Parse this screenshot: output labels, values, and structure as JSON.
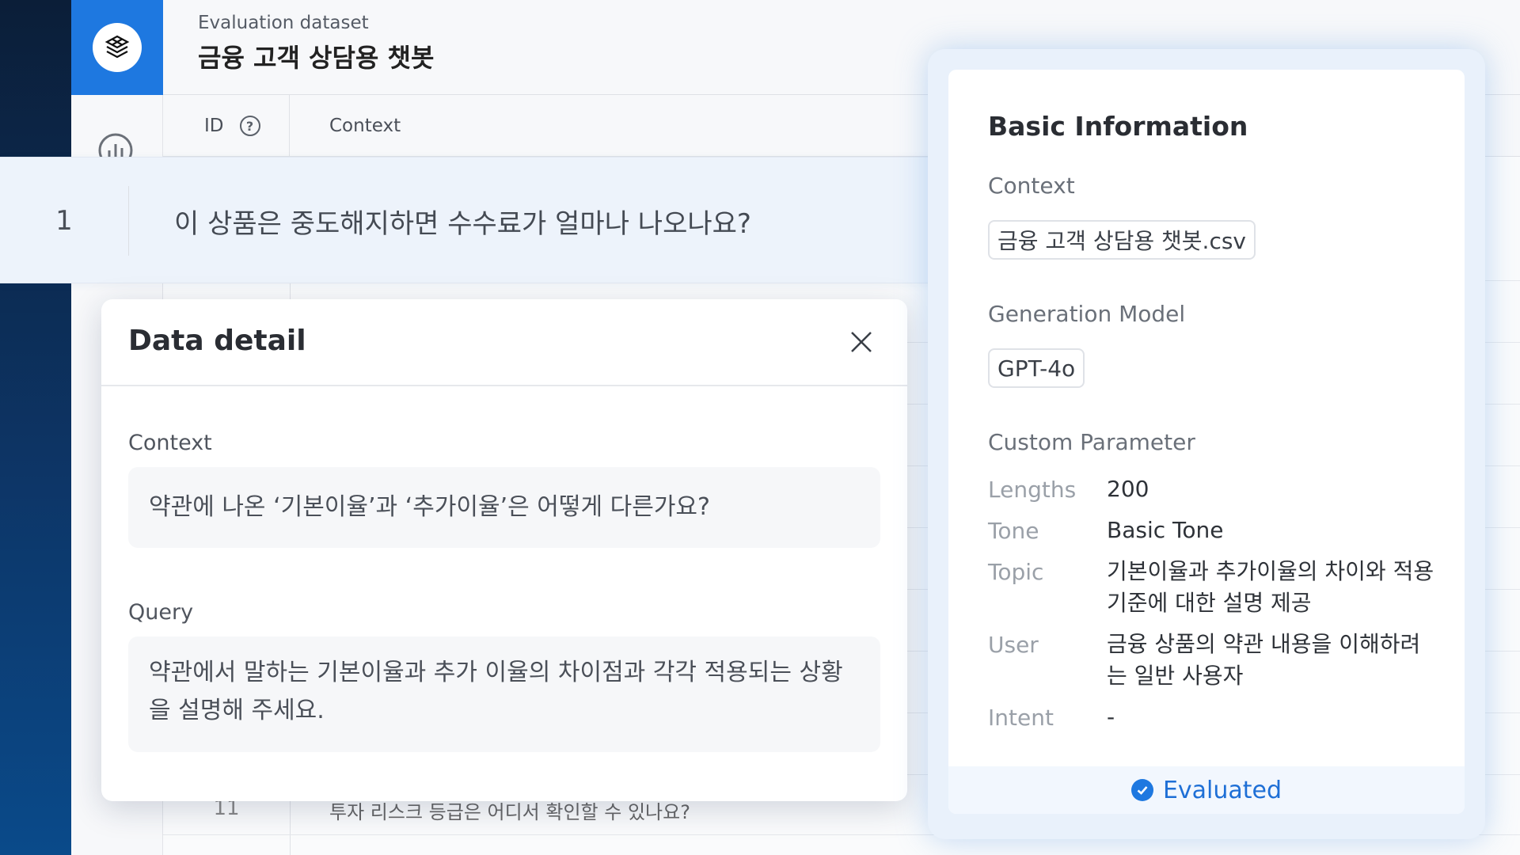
{
  "header": {
    "subtitle": "Evaluation dataset",
    "title": "금융 고객 상담용 챗봇"
  },
  "table": {
    "columns": {
      "id": "ID",
      "context": "Context"
    },
    "highlighted_row": {
      "id": "1",
      "context": "이 상품은 중도해지하면 수수료가 얼마나 나오나요?"
    },
    "partial_row": {
      "id": "11",
      "context": "투자 리스크 등급은 어디서 확인할 수 있나요?"
    }
  },
  "modal": {
    "title": "Data detail",
    "context_label": "Context",
    "context_value": "약관에 나온 ‘기본이율’과 ‘추가이율’은 어떻게 다른가요?",
    "query_label": "Query",
    "query_value": "약관에서 말하는 기본이율과 추가 이율의 차이점과 각각 적용되는 상황을 설명해 주세요."
  },
  "info_panel": {
    "title": "Basic Information",
    "context_label": "Context",
    "context_file": "금융 고객 상담용 챗봇.csv",
    "model_label": "Generation Model",
    "model_value": "GPT-4o",
    "custom_label": "Custom Parameter",
    "params": [
      {
        "key": "Lengths",
        "value": "200"
      },
      {
        "key": "Tone",
        "value": "Basic Tone"
      },
      {
        "key": "Topic",
        "value": "기본이율과 추가이율의 차이와 적용 기준에 대한 설명 제공"
      },
      {
        "key": "User",
        "value": "금융 상품의 약관 내용을 이해하려는 일반 사용자"
      },
      {
        "key": "Intent",
        "value": "-"
      }
    ],
    "status": "Evaluated"
  },
  "colors": {
    "brand": "#1e78e0",
    "evaluated": "#1e6fd6"
  },
  "icons": [
    "logo-icon",
    "chart-icon",
    "help-icon",
    "close-icon",
    "check-circle-icon"
  ]
}
